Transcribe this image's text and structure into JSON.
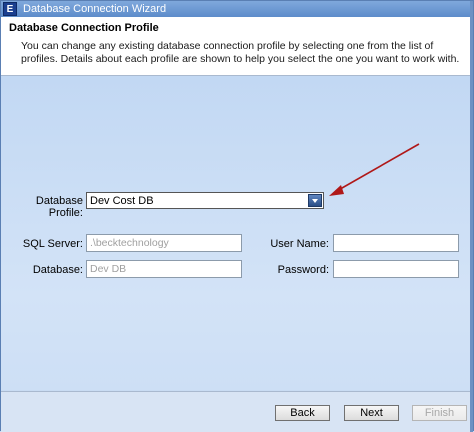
{
  "window": {
    "title": "Database Connection Wizard",
    "icon_letter": "E"
  },
  "header": {
    "title": "Database Connection Profile",
    "description": "You can change any existing database connection profile by selecting one from the list of profiles.  Details about each profile are shown to help you select the one you want to work with."
  },
  "profile": {
    "label": "Database Profile:",
    "selected": "Dev Cost DB"
  },
  "fields": {
    "sql_server_label": "SQL Server:",
    "sql_server_value": ".\\becktechnology",
    "database_label": "Database:",
    "database_value": "Dev DB",
    "username_label": "User Name:",
    "username_value": "",
    "password_label": "Password:",
    "password_value": ""
  },
  "buttons": {
    "back": "Back",
    "next": "Next",
    "finish": "Finish"
  },
  "colors": {
    "arrow": "#b01818",
    "titlebar": "#6a96d2"
  }
}
